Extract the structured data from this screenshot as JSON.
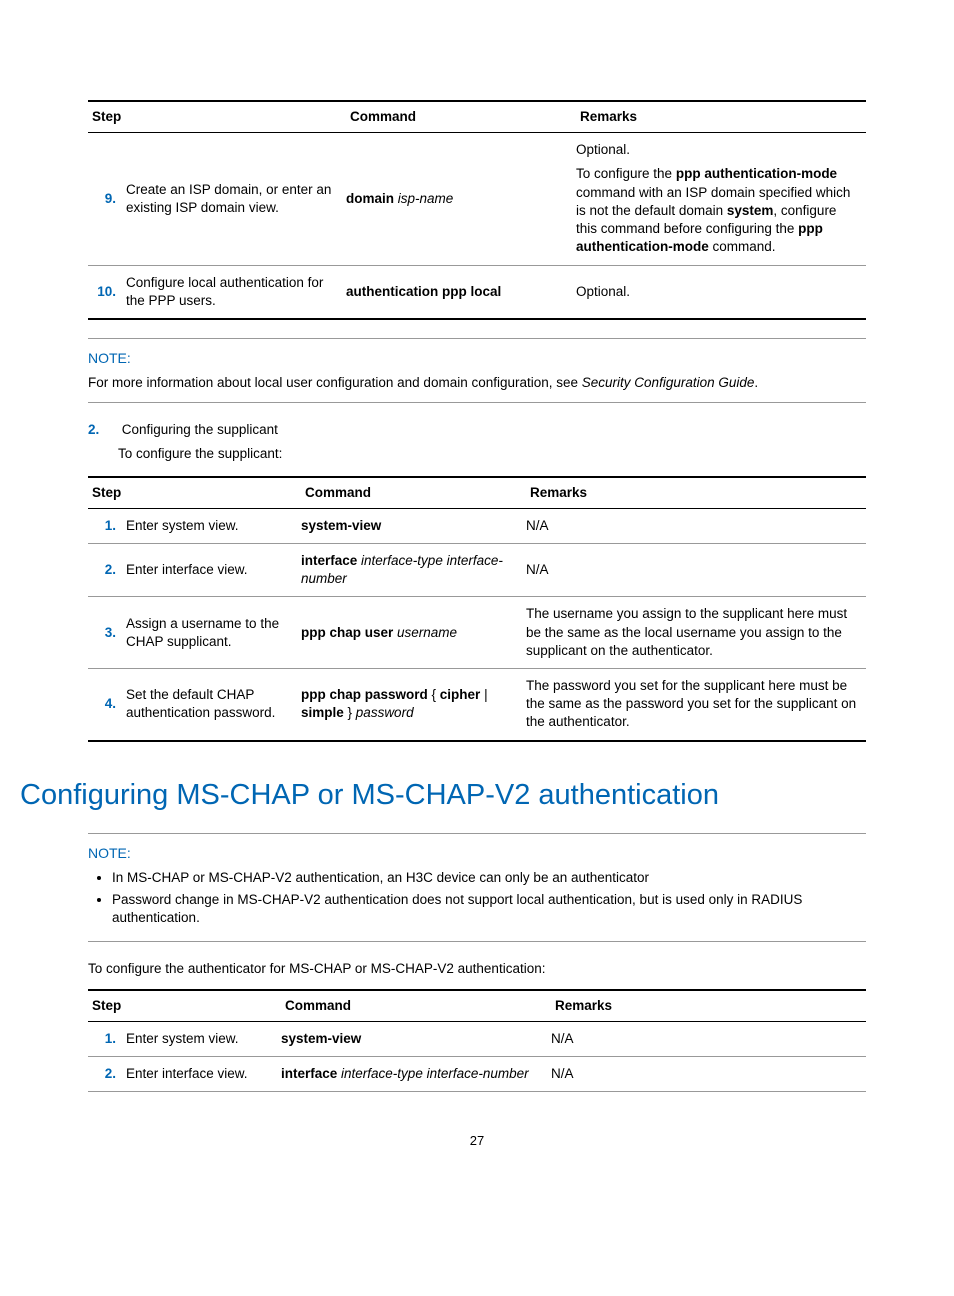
{
  "table1": {
    "headers": {
      "step": "Step",
      "command": "Command",
      "remarks": "Remarks"
    },
    "rows": [
      {
        "num": "9.",
        "desc": "Create an ISP domain, or enter an existing ISP domain view.",
        "cmd_b1": "domain ",
        "cmd_i1": "isp-name",
        "rem_p1": "Optional.",
        "rem_p2_a": "To configure the ",
        "rem_p2_b1": "ppp authentication-mode",
        "rem_p2_c": " command with an ISP domain specified which is not the default domain ",
        "rem_p2_b2": "system",
        "rem_p2_d": ", configure this command before configuring the ",
        "rem_p2_b3": "ppp authentication-mode",
        "rem_p2_e": " command."
      },
      {
        "num": "10.",
        "desc": "Configure local authentication for the PPP users.",
        "cmd_b1": "authentication ppp local",
        "rem_p1": "Optional."
      }
    ]
  },
  "note1": {
    "label": "NOTE:",
    "text_a": "For more information about local user configuration and domain configuration, see ",
    "text_i": "Security Configuration Guide",
    "text_b": "."
  },
  "step2": {
    "num": "2.",
    "title": "Configuring the supplicant",
    "sub": "To configure the supplicant:"
  },
  "table2": {
    "headers": {
      "step": "Step",
      "command": "Command",
      "remarks": "Remarks"
    },
    "rows": [
      {
        "num": "1.",
        "desc": "Enter system view.",
        "cmd_b1": "system-view",
        "rem": "N/A"
      },
      {
        "num": "2.",
        "desc": "Enter interface view.",
        "cmd_b1": "interface ",
        "cmd_i1": "interface-type interface-number",
        "rem": "N/A"
      },
      {
        "num": "3.",
        "desc": "Assign a username to the CHAP supplicant.",
        "cmd_b1": "ppp chap user ",
        "cmd_i1": "username",
        "rem": "The username you assign to the supplicant here must be the same as the local username you assign to the supplicant on the authenticator."
      },
      {
        "num": "4.",
        "desc": "Set the default CHAP authentication password.",
        "cmd_b1": "ppp chap password",
        "cmd_t1": " { ",
        "cmd_b2": "cipher",
        "cmd_t2": " | ",
        "cmd_b3": "simple",
        "cmd_t3": " } ",
        "cmd_i1": "password",
        "rem": "The password you set for the supplicant here must be the same as the password you set for the supplicant on the authenticator."
      }
    ]
  },
  "heading2": "Configuring MS-CHAP or MS-CHAP-V2 authentication",
  "note2": {
    "label": "NOTE:",
    "items": [
      "In MS-CHAP or MS-CHAP-V2 authentication, an H3C device can only be an authenticator",
      "Password change in MS-CHAP-V2 authentication does not support local authentication, but is used only in RADIUS authentication."
    ]
  },
  "intro3": "To configure the authenticator for MS-CHAP or MS-CHAP-V2 authentication:",
  "table3": {
    "headers": {
      "step": "Step",
      "command": "Command",
      "remarks": "Remarks"
    },
    "rows": [
      {
        "num": "1.",
        "desc": "Enter system view.",
        "cmd_b1": "system-view",
        "rem": "N/A"
      },
      {
        "num": "2.",
        "desc": "Enter interface view.",
        "cmd_b1": "interface ",
        "cmd_i1": "interface-type interface-number",
        "rem": "N/A"
      }
    ]
  },
  "pageNum": "27"
}
